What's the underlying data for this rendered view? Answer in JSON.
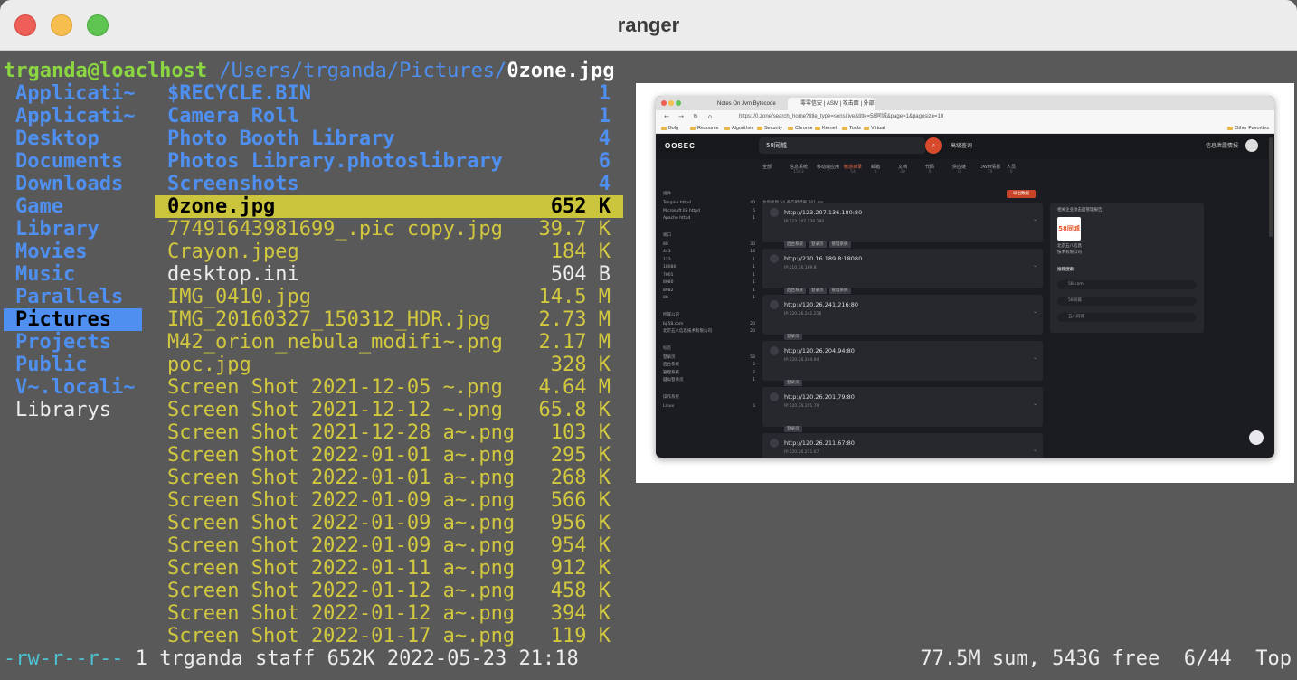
{
  "window": {
    "title": "ranger"
  },
  "path": {
    "user_host": "trganda@loaclhost",
    "dir": " /Users/trganda/Pictures/",
    "file": "0zone.jpg"
  },
  "parent_dirs": [
    {
      "name": "Applicati~"
    },
    {
      "name": "Applicati~"
    },
    {
      "name": "Desktop"
    },
    {
      "name": "Documents"
    },
    {
      "name": "Downloads"
    },
    {
      "name": "Game"
    },
    {
      "name": "Library"
    },
    {
      "name": "Movies"
    },
    {
      "name": "Music"
    },
    {
      "name": "Parallels"
    },
    {
      "name": "Pictures"
    },
    {
      "name": "Projects"
    },
    {
      "name": "Public"
    },
    {
      "name": "V~.locali~"
    },
    {
      "name": "Librarys"
    }
  ],
  "files": [
    {
      "name": "$RECYCLE.BIN",
      "size": "1",
      "kind": "dir"
    },
    {
      "name": "Camera Roll",
      "size": "1",
      "kind": "dir"
    },
    {
      "name": "Photo Booth Library",
      "size": "4",
      "kind": "dir"
    },
    {
      "name": "Photos Library.photoslibrary",
      "size": "6",
      "kind": "dir"
    },
    {
      "name": "Screenshots",
      "size": "4",
      "kind": "dir"
    },
    {
      "name": "0zone.jpg",
      "size": "652 K",
      "kind": "sel"
    },
    {
      "name": "77491643981699_.pic copy.jpg",
      "size": "39.7 K",
      "kind": "img"
    },
    {
      "name": "Crayon.jpeg",
      "size": "184 K",
      "kind": "img"
    },
    {
      "name": "desktop.ini",
      "size": "504 B",
      "kind": "txt"
    },
    {
      "name": "IMG_0410.jpg",
      "size": "14.5 M",
      "kind": "img"
    },
    {
      "name": "IMG_20160327_150312_HDR.jpg",
      "size": "2.73 M",
      "kind": "img"
    },
    {
      "name": "M42_orion_nebula_modifi~.png",
      "size": "2.17 M",
      "kind": "img"
    },
    {
      "name": "poc.jpg",
      "size": "328 K",
      "kind": "img"
    },
    {
      "name": "Screen Shot 2021-12-05 ~.png",
      "size": "4.64 M",
      "kind": "img"
    },
    {
      "name": "Screen Shot 2021-12-12 ~.png",
      "size": "65.8 K",
      "kind": "img"
    },
    {
      "name": "Screen Shot 2021-12-28 a~.png",
      "size": "103 K",
      "kind": "img"
    },
    {
      "name": "Screen Shot 2022-01-01 a~.png",
      "size": "295 K",
      "kind": "img"
    },
    {
      "name": "Screen Shot 2022-01-01 a~.png",
      "size": "268 K",
      "kind": "img"
    },
    {
      "name": "Screen Shot 2022-01-09 a~.png",
      "size": "566 K",
      "kind": "img"
    },
    {
      "name": "Screen Shot 2022-01-09 a~.png",
      "size": "956 K",
      "kind": "img"
    },
    {
      "name": "Screen Shot 2022-01-09 a~.png",
      "size": "954 K",
      "kind": "img"
    },
    {
      "name": "Screen Shot 2022-01-11 a~.png",
      "size": "912 K",
      "kind": "img"
    },
    {
      "name": "Screen Shot 2022-01-12 a~.png",
      "size": "458 K",
      "kind": "img"
    },
    {
      "name": "Screen Shot 2022-01-12 a~.png",
      "size": "394 K",
      "kind": "img"
    },
    {
      "name": "Screen Shot 2022-01-17 a~.png",
      "size": "119 K",
      "kind": "img"
    }
  ],
  "status": {
    "perm": "-rw-r--r--",
    "info": " 1 trganda staff 652K 2022-05-23 21:18",
    "right": "77.5M sum, 543G free  6/44  Top"
  },
  "preview": {
    "tabs": [
      "Notes On Jvm Bytecode",
      "零零信安 | ASM | 攻击面 | 外部..."
    ],
    "url": "https://0.zone/search_home?title_type=sensitive&title=58同城&page=1&pagesize=10",
    "bookmarks": [
      "Bolg",
      "Resource",
      "Algorithm",
      "Security",
      "Chrome",
      "Kernel",
      "Tools",
      "Virtual"
    ],
    "other_favorites": "Other Favorites",
    "logo": "OOSEC",
    "search_value": "58同城",
    "advanced": "高级查询",
    "info_link": "信息泄露情报",
    "categories": [
      {
        "label": "全部",
        "count": ""
      },
      {
        "label": "信息系统",
        "count": "1563"
      },
      {
        "label": "移动端应用",
        "count": "7"
      },
      {
        "label": "敏感目录",
        "count": "54"
      },
      {
        "label": "邮箱",
        "count": "0"
      },
      {
        "label": "文档",
        "count": "30"
      },
      {
        "label": "代码",
        "count": "0"
      },
      {
        "label": "供应链",
        "count": "0"
      },
      {
        "label": "DWM情报",
        "count": "19"
      },
      {
        "label": "人员",
        "count": "0"
      }
    ],
    "result_text": "为您找到 54 条匹配结果 261 ms",
    "export_btn": "导出数据",
    "side_groups": [
      {
        "title": "组件",
        "items": [
          [
            "Tengine httpd",
            "40"
          ],
          [
            "Microsoft IIS httpd",
            "5"
          ],
          [
            "Apache httpd",
            "1"
          ]
        ]
      },
      {
        "title": "端口",
        "items": [
          [
            "80",
            "30"
          ],
          [
            "443",
            "16"
          ],
          [
            "123",
            "1"
          ],
          [
            "18080",
            "1"
          ],
          [
            "7001",
            "1"
          ],
          [
            "8080",
            "1"
          ],
          [
            "8082",
            "1"
          ],
          [
            "88",
            "1"
          ]
        ]
      },
      {
        "title": "所属公司",
        "items": [
          [
            "bj.58.com",
            "20"
          ],
          [
            "北京五八信息技术有限公司",
            "20"
          ]
        ]
      },
      {
        "title": "标签",
        "items": [
          [
            "登录页",
            "53"
          ],
          [
            "后台系统",
            "2"
          ],
          [
            "管理系统",
            "2"
          ],
          [
            "疑似登录页",
            "1"
          ]
        ]
      },
      {
        "title": "操作系统",
        "items": [
          [
            "Linux",
            "5"
          ]
        ]
      }
    ],
    "cards": [
      {
        "url": "http://123.207.136.180:80",
        "ip": "IP:123.207.136.180",
        "tags": [
          "后台系统",
          "登录页",
          "管理系统"
        ]
      },
      {
        "url": "http://210.16.189.8:18080",
        "ip": "IP:210.16.189.8",
        "tags": [
          "后台系统",
          "登录页",
          "管理系统"
        ]
      },
      {
        "url": "http://120.26.241.216:80",
        "ip": "IP:120.26.241.216",
        "tags": [
          "登录页"
        ]
      },
      {
        "url": "http://120.26.204.94:80",
        "ip": "IP:120.26.204.94",
        "tags": [
          "登录页"
        ]
      },
      {
        "url": "http://120.26.201.79:80",
        "ip": "IP:120.26.201.79",
        "tags": [
          "登录页"
        ]
      },
      {
        "url": "http://120.26.211.67:80",
        "ip": "IP:120.26.211.67",
        "tags": []
      }
    ],
    "right_panel": {
      "title": "相关企业攻击面管理报告",
      "logo_text": "58同城",
      "company": "北京五八信息",
      "company2": "技术有限公司",
      "recommend": "推荐搜索",
      "suggestions": [
        "58.com",
        "58同城",
        "五八同城"
      ]
    }
  }
}
